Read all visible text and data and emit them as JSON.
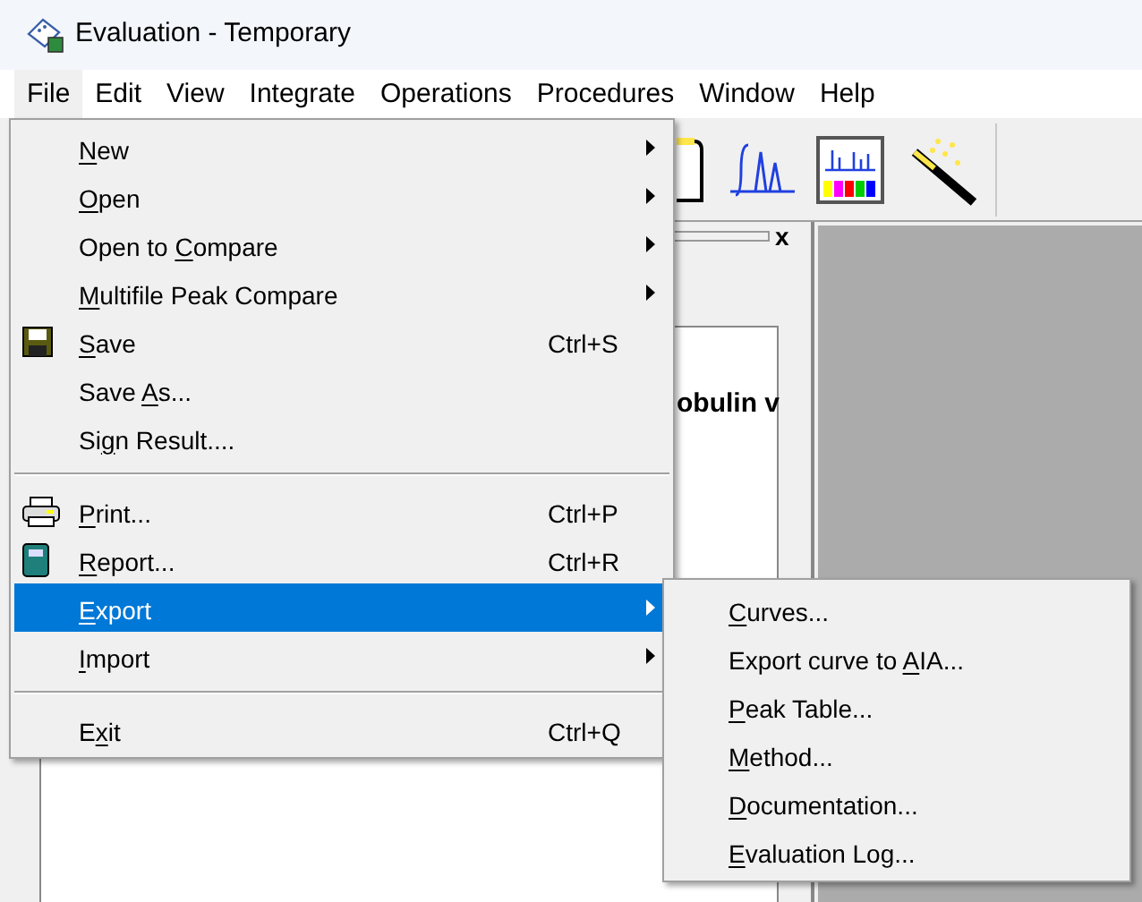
{
  "window": {
    "title": "Evaluation - Temporary"
  },
  "menubar": [
    {
      "label": "File",
      "selected": true
    },
    {
      "label": "Edit",
      "selected": false
    },
    {
      "label": "View",
      "selected": false
    },
    {
      "label": "Integrate",
      "selected": false
    },
    {
      "label": "Operations",
      "selected": false
    },
    {
      "label": "Procedures",
      "selected": false
    },
    {
      "label": "Window",
      "selected": false
    },
    {
      "label": "Help",
      "selected": false
    }
  ],
  "pane": {
    "close": "x",
    "text": "obulin v"
  },
  "file_menu": [
    {
      "kind": "item",
      "label": {
        "key": "N",
        "after": "ew"
      },
      "submenu": true,
      "selected": false
    },
    {
      "kind": "item",
      "label": {
        "key": "O",
        "after": "pen"
      },
      "submenu": true,
      "selected": false
    },
    {
      "kind": "item",
      "label": {
        "before": "Open to ",
        "key": "C",
        "after": "ompare"
      },
      "submenu": true,
      "selected": false
    },
    {
      "kind": "item",
      "label": {
        "key": "M",
        "after": "ultifile Peak Compare"
      },
      "submenu": true,
      "selected": false
    },
    {
      "kind": "icon",
      "label": {
        "key": "S",
        "after": "ave"
      },
      "shortcut": "Ctrl+S",
      "selected": false
    },
    {
      "kind": "item",
      "label": {
        "before": "Save ",
        "key": "A",
        "after": "s..."
      },
      "selected": false
    },
    {
      "kind": "item",
      "label": {
        "before": "Si",
        "key": "g",
        "after": "n Result...."
      },
      "selected": false
    },
    {
      "kind": "separator"
    },
    {
      "kind": "icon",
      "label": {
        "key": "P",
        "after": "rint..."
      },
      "shortcut": "Ctrl+P",
      "selected": false
    },
    {
      "kind": "icon",
      "label": {
        "key": "R",
        "after": "eport..."
      },
      "shortcut": "Ctrl+R",
      "selected": false
    },
    {
      "kind": "item",
      "label": {
        "key": "E",
        "after": "xport"
      },
      "submenu": true,
      "selected": true
    },
    {
      "kind": "item",
      "label": {
        "key": "I",
        "after": "mport"
      },
      "submenu": true,
      "selected": false
    },
    {
      "kind": "separator"
    },
    {
      "kind": "item",
      "label": {
        "before": "E",
        "key": "x",
        "after": "it"
      },
      "shortcut": "Ctrl+Q",
      "selected": false
    }
  ],
  "export_menu": [
    {
      "label": {
        "key": "C",
        "after": "urves..."
      }
    },
    {
      "label": {
        "before": "Export curve to ",
        "key": "A",
        "after": "IA..."
      }
    },
    {
      "label": {
        "key": "P",
        "after": "eak Table..."
      }
    },
    {
      "label": {
        "key": "M",
        "after": "ethod..."
      }
    },
    {
      "label": {
        "key": "D",
        "after": "ocumentation..."
      }
    },
    {
      "label": {
        "key": "E",
        "after": "valuation Log..."
      }
    }
  ]
}
